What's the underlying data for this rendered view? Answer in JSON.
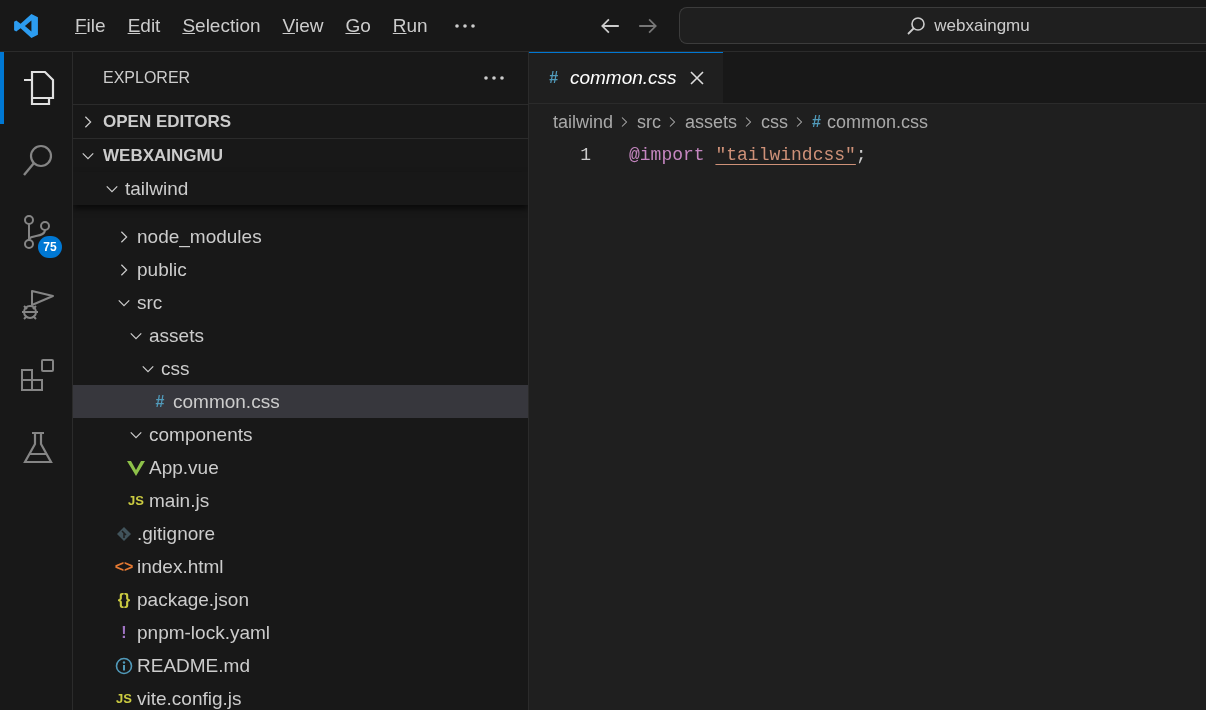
{
  "title_bar": {
    "menus": [
      "File",
      "Edit",
      "Selection",
      "View",
      "Go",
      "Run"
    ],
    "search": {
      "value": "webxaingmu"
    }
  },
  "activity_bar": [
    {
      "kind": "explorer",
      "selected": true
    },
    {
      "kind": "search",
      "selected": false
    },
    {
      "kind": "source-control",
      "selected": false,
      "badge": "75"
    },
    {
      "kind": "run-debug",
      "selected": false
    },
    {
      "kind": "extensions",
      "selected": false
    },
    {
      "kind": "testing",
      "selected": false
    }
  ],
  "sidebar": {
    "title": "EXPLORER",
    "sections": [
      {
        "label": "OPEN EDITORS",
        "expanded": false
      },
      {
        "label": "WEBXAINGMU",
        "expanded": true
      }
    ],
    "tree": [
      {
        "label": "tailwind",
        "kind": "folder",
        "expanded": true,
        "selected": false,
        "children": [
          {
            "label": "node_modules",
            "kind": "folder",
            "expanded": false,
            "selected": false
          },
          {
            "label": "public",
            "kind": "folder",
            "expanded": false,
            "selected": false
          },
          {
            "label": "src",
            "kind": "folder",
            "expanded": true,
            "selected": false,
            "children": [
              {
                "label": "assets",
                "kind": "folder",
                "expanded": true,
                "selected": false,
                "children": [
                  {
                    "label": "css",
                    "kind": "folder",
                    "expanded": true,
                    "selected": false,
                    "children": [
                      {
                        "label": "common.css",
                        "kind": "css",
                        "icon": "#",
                        "selected": true
                      }
                    ]
                  }
                ]
              },
              {
                "label": "components",
                "kind": "folder",
                "expanded": true,
                "selected": false
              },
              {
                "label": "App.vue",
                "kind": "vue",
                "selected": false
              },
              {
                "label": "main.js",
                "kind": "js",
                "icon": "JS",
                "selected": false
              }
            ]
          },
          {
            "label": ".gitignore",
            "kind": "git",
            "selected": false
          },
          {
            "label": "index.html",
            "kind": "html",
            "icon": "<>",
            "selected": false
          },
          {
            "label": "package.json",
            "kind": "json",
            "icon": "{}",
            "selected": false
          },
          {
            "label": "pnpm-lock.yaml",
            "kind": "yaml",
            "icon": "!",
            "selected": false
          },
          {
            "label": "README.md",
            "kind": "info",
            "selected": false
          },
          {
            "label": "vite.config.js",
            "kind": "js",
            "icon": "JS",
            "selected": false
          }
        ]
      }
    ]
  },
  "editor": {
    "tabs": [
      {
        "label": "common.css",
        "kind": "css",
        "icon": "#",
        "selected": true
      }
    ],
    "breadcrumb": [
      {
        "label": "tailwind"
      },
      {
        "label": "src"
      },
      {
        "label": "assets"
      },
      {
        "label": "css"
      },
      {
        "label": "common.css",
        "kind": "css",
        "icon": "#"
      }
    ],
    "lines": [
      {
        "number": "1",
        "tokens": [
          {
            "kind": "keyword",
            "text": "@import"
          },
          {
            "kind": "string",
            "text": "\"tailwindcss\""
          },
          {
            "kind": "punct",
            "text": ";"
          }
        ]
      }
    ]
  }
}
